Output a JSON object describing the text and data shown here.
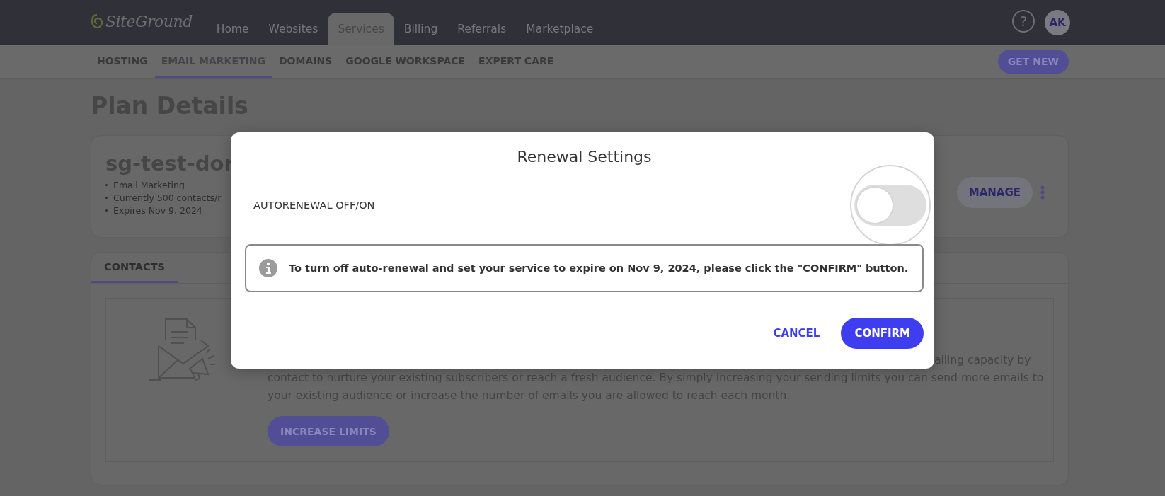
{
  "top_nav": {
    "logo": "SiteGround",
    "items": [
      {
        "label": "Home",
        "selected": false
      },
      {
        "label": "Websites",
        "selected": false
      },
      {
        "label": "Services",
        "selected": true
      },
      {
        "label": "Billing",
        "selected": false
      },
      {
        "label": "Referrals",
        "selected": false
      },
      {
        "label": "Marketplace",
        "selected": false
      }
    ],
    "help": "?",
    "avatar": "AK"
  },
  "sub_nav": {
    "items": [
      {
        "label": "HOSTING",
        "selected": false
      },
      {
        "label": "EMAIL MARKETING",
        "selected": true
      },
      {
        "label": "DOMAINS",
        "selected": false
      },
      {
        "label": "GOOGLE WORKSPACE",
        "selected": false
      },
      {
        "label": "EXPERT CARE",
        "selected": false
      }
    ],
    "button": "GET NEW"
  },
  "page_title": "Plan Details",
  "plan_card": {
    "name": "sg-test-dor",
    "details": [
      "Email Marketing",
      "Currently 500 contacts/r",
      "Expires Nov 9, 2024"
    ],
    "manage_button": "MANAGE"
  },
  "contacts_panel": {
    "tabs": [
      {
        "label": "CONTACTS",
        "selected": true
      }
    ],
    "description": [
      "ailing capacity by",
      "contact to nurture your existing subscribers or reach a fresh audience. By simply increasing your sending limits you can send more emails to",
      "your existing audience or increase the number of emails you are allowed to reach each month."
    ],
    "button": "INCREASE LIMITS"
  },
  "dialog": {
    "title": "Renewal Settings",
    "setting": {
      "label": "AUTORENEWAL OFF/ON",
      "on": false
    },
    "notice": "To turn off auto-renewal and set your service to expire on Nov 9, 2024, please click the \"CONFIRM\" button.",
    "buttons": [
      {
        "label": "CANCEL",
        "kind": "text"
      },
      {
        "label": "CONFIRM",
        "kind": "primary"
      }
    ]
  }
}
